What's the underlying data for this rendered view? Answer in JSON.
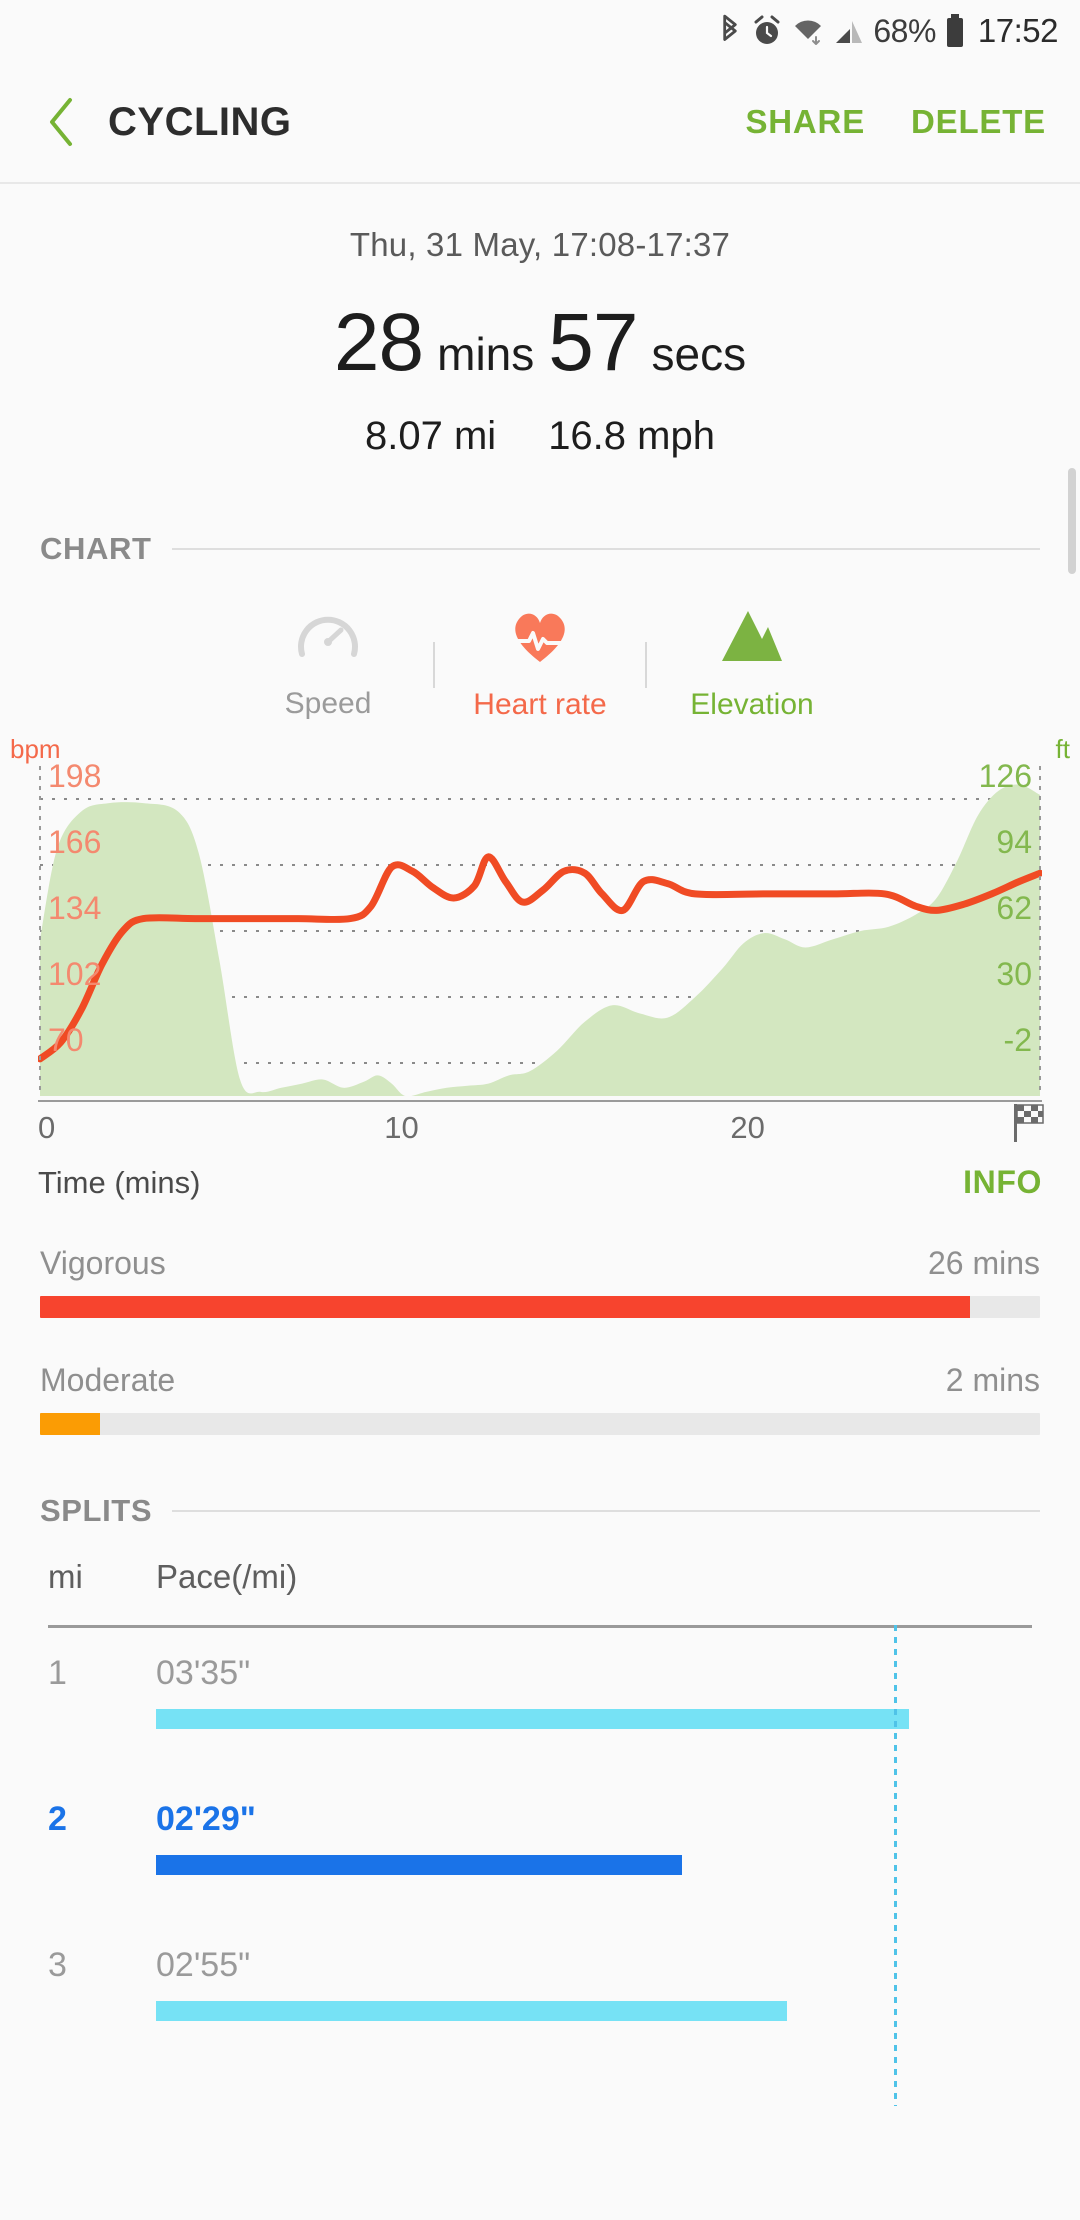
{
  "status_bar": {
    "icons": [
      "bluetooth-icon",
      "alarm-icon",
      "wifi-icon",
      "signal-icon"
    ],
    "battery_percent": "68%",
    "clock": "17:52"
  },
  "app_bar": {
    "back": "back-icon",
    "title": "CYCLING",
    "share_label": "SHARE",
    "delete_label": "DELETE",
    "accent_color": "#76b334"
  },
  "summary": {
    "datetime": "Thu, 31 May, 17:08-17:37",
    "duration_minutes": "28",
    "minutes_unit": "mins",
    "duration_seconds": "57",
    "seconds_unit": "secs",
    "distance": "8.07 mi",
    "speed": "16.8 mph"
  },
  "chart_section": {
    "label": "CHART",
    "tabs": [
      {
        "label": "Speed",
        "icon": "speedometer-icon",
        "active": false,
        "color": "#9b9b9b"
      },
      {
        "label": "Heart rate",
        "icon": "heart-pulse-icon",
        "active": true,
        "color": "#f4694a"
      },
      {
        "label": "Elevation",
        "icon": "mountain-icon",
        "active": true,
        "color": "#76b334"
      }
    ],
    "xlabel": "Time (mins)",
    "info_label": "INFO",
    "end_icon": "checkered-flag-icon"
  },
  "chart_data": {
    "type": "line",
    "title": "",
    "xlabel": "Time (mins)",
    "x_ticks": [
      "0",
      "10",
      "20"
    ],
    "x_tick_values": [
      0,
      10,
      20
    ],
    "xlim": [
      0,
      29
    ],
    "grid": true,
    "legend": [
      "Heart rate",
      "Elevation"
    ],
    "legend_position": "top",
    "axes": [
      {
        "side": "left",
        "unit": "bpm",
        "label": "bpm",
        "color": "#f4896f",
        "ticks": [
          198,
          166,
          134,
          102,
          70
        ],
        "ylim": [
          54,
          214
        ]
      },
      {
        "side": "right",
        "unit": "ft",
        "label": "ft",
        "color": "#83b84e",
        "ticks": [
          126,
          94,
          62,
          30,
          -2
        ],
        "ylim": [
          -18,
          142
        ]
      }
    ],
    "series": [
      {
        "name": "Heart rate",
        "axis": "left",
        "unit": "bpm",
        "type": "line",
        "color": "#f04b24",
        "x": [
          0.0,
          0.6,
          1.2,
          1.8,
          2.4,
          3.0,
          4.5,
          6.0,
          7.5,
          9.0,
          9.6,
          10.2,
          10.8,
          11.4,
          12.0,
          12.6,
          13.0,
          13.5,
          14.0,
          14.6,
          15.2,
          15.8,
          16.3,
          16.9,
          17.5,
          18.2,
          19.0,
          21.0,
          23.0,
          24.5,
          25.4,
          26.0,
          26.8,
          27.6,
          28.4,
          29.0
        ],
        "y": [
          72,
          80,
          96,
          118,
          134,
          140,
          140,
          140,
          140,
          140,
          146,
          165,
          163,
          155,
          150,
          156,
          170,
          158,
          148,
          154,
          163,
          162,
          152,
          144,
          158,
          157,
          152,
          152,
          152,
          152,
          146,
          144,
          147,
          152,
          158,
          162
        ]
      },
      {
        "name": "Elevation",
        "axis": "right",
        "unit": "ft",
        "type": "area",
        "color": "#d3e7c0",
        "x": [
          0.0,
          0.5,
          1.2,
          2.0,
          3.0,
          4.0,
          4.6,
          5.2,
          5.8,
          6.4,
          7.0,
          7.6,
          8.2,
          8.8,
          9.4,
          9.8,
          10.2,
          10.6,
          11.2,
          11.8,
          12.4,
          13.0,
          13.6,
          14.2,
          15.0,
          15.8,
          16.6,
          17.4,
          18.2,
          19.0,
          19.8,
          20.4,
          21.0,
          21.6,
          22.2,
          23.0,
          23.8,
          24.6,
          25.4,
          26.0,
          26.6,
          27.2,
          27.8,
          28.4,
          29.0
        ],
        "y": [
          58,
          102,
          120,
          124,
          124,
          120,
          100,
          48,
          -10,
          -16,
          -14,
          -12,
          -10,
          -14,
          -11,
          -8,
          -12,
          -18,
          -16,
          -14,
          -13,
          -12,
          -8,
          -6,
          4,
          18,
          26,
          22,
          20,
          30,
          44,
          56,
          61,
          58,
          54,
          58,
          62,
          64,
          70,
          78,
          96,
          118,
          130,
          133,
          128
        ]
      }
    ]
  },
  "intensity": {
    "rows": [
      {
        "name": "Vigorous",
        "value": "26 mins",
        "percent": 93,
        "color": "#f7442e"
      },
      {
        "name": "Moderate",
        "value": "2 mins",
        "percent": 6,
        "color": "#fb9c04"
      }
    ]
  },
  "splits": {
    "label": "SPLITS",
    "columns": {
      "index": "mi",
      "pace": "Pace(/mi)"
    },
    "marker_percent": 86,
    "rows": [
      {
        "index": "1",
        "pace": "03'35\"",
        "percent": 86,
        "fastest": false
      },
      {
        "index": "2",
        "pace": "02'29\"",
        "percent": 60,
        "fastest": true
      },
      {
        "index": "3",
        "pace": "02'55\"",
        "percent": 72,
        "fastest": false
      }
    ]
  }
}
